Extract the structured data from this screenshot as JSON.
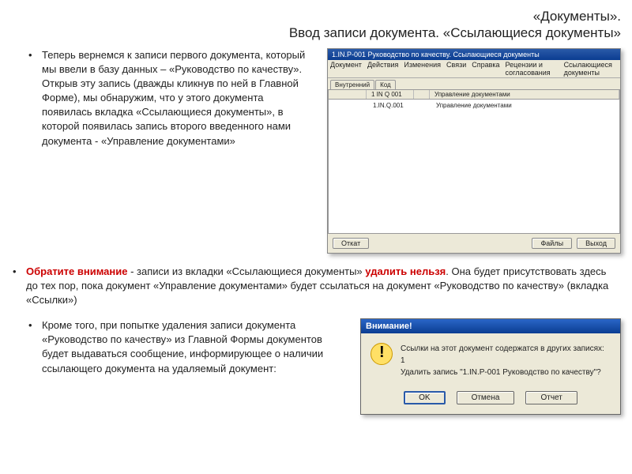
{
  "title_line1": "«Документы».",
  "title_line2": "Ввод записи документа. «Ссылающиеся документы»",
  "para1": "Теперь вернемся к записи первого документа, который мы ввели в базу данных – «Руководство по качеству». Открыв эту запись (дважды кликнув по ней в Главной Форме), мы обнаружим, что у этого документа появилась вкладка «Ссылающиеся документы», в которой появилась запись второго введенного нами документа  - «Управление документами»",
  "note_lead_strong": "Обратите внимание",
  "note_mid_plain": " -  записи из вкладки «Ссылающиеся документы» ",
  "note_strong2": "удалить нельзя",
  "note_tail": ". Она будет присутствовать здесь до тех пор, пока документ «Управление документами» будет ссылаться на документ «Руководство по качеству» (вкладка «Ссылки»)",
  "para3": "Кроме того, при попытке удаления записи документа «Руководство по качеству» из Главной Формы документов будет выдаваться сообщение, информирующее о наличии ссылающего документа на удаляемый документ:",
  "appwin": {
    "title": "1.IN.P-001 Руководство по качеству. Ссылающиеся документы",
    "menu": [
      "Документ",
      "Действия",
      "Изменения",
      "Связи",
      "Справка",
      "Рецензии и согласования",
      "Ссылающиеся документы"
    ],
    "tabs": [
      "Внутренний",
      "Код"
    ],
    "thead": [
      "",
      "1 IN Q 001",
      "",
      "Управление документами"
    ],
    "row": {
      "c1": "",
      "c2": "1.IN.Q.001",
      "c3": "",
      "c4": "Управление документами"
    },
    "btn_open": "Откат",
    "btn_files": "Файлы",
    "btn_exit": "Выход"
  },
  "dialog": {
    "title": "Внимание!",
    "line1": "Ссылки на этот документ содержатся в других записях: 1",
    "line2": "Удалить запись \"1.IN.P-001 Руководство по качеству\"?",
    "ok": "OK",
    "cancel": "Отмена",
    "report": "Отчет"
  }
}
